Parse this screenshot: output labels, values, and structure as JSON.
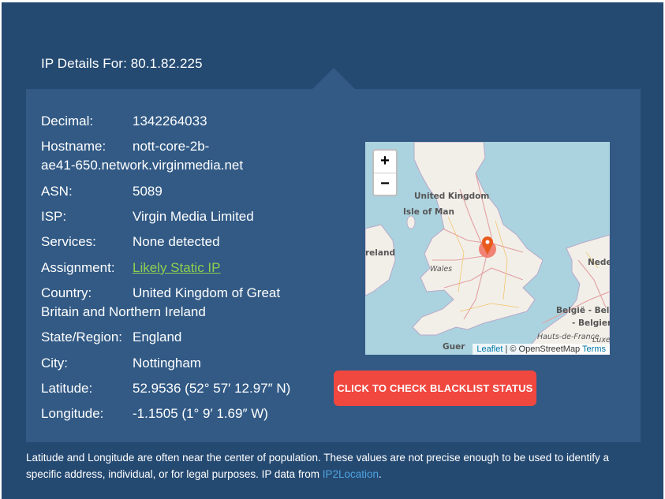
{
  "header": {
    "title_prefix": "IP Details For:",
    "ip": "80.1.82.225"
  },
  "details": {
    "decimal": {
      "label": "Decimal:",
      "value": "1342264033"
    },
    "hostname": {
      "label": "Hostname:",
      "value_line1": "nott-core-2b-",
      "value_line2": "ae41-650.network.virginmedia.net"
    },
    "asn": {
      "label": "ASN:",
      "value": "5089"
    },
    "isp": {
      "label": "ISP:",
      "value": "Virgin Media Limited"
    },
    "services": {
      "label": "Services:",
      "value": "None detected"
    },
    "assignment": {
      "label": "Assignment:",
      "value": "Likely Static IP"
    },
    "country": {
      "label": "Country:",
      "value_line1": "United Kingdom of Great",
      "value_line2": "Britain and Northern Ireland"
    },
    "state": {
      "label": "State/Region:",
      "value": "England"
    },
    "city": {
      "label": "City:",
      "value": "Nottingham"
    },
    "latitude": {
      "label": "Latitude:",
      "value": "52.9536 (52° 57′ 12.97″ N)"
    },
    "longitude": {
      "label": "Longitude:",
      "value": "-1.1505 (1° 9′ 1.69″ W)"
    }
  },
  "map": {
    "zoom_in": "+",
    "zoom_out": "−",
    "labels": {
      "uk": "United Kingdom",
      "isle_of_man": "Isle of Man",
      "ireland": "reland",
      "wales": "Wales",
      "nederland": "Nede",
      "belgie": "België - Belgi",
      "belgien": "- Belgien",
      "hauts": "Hauts-de-France",
      "luxe": "Luxe",
      "guer": "Guer"
    },
    "attribution": {
      "leaflet": "Leaflet",
      "sep": " | © OpenStreetMap ",
      "terms": "Terms"
    },
    "colors": {
      "sea": "#aad3df",
      "land": "#f2efe9",
      "marker": "#e85a1c"
    }
  },
  "blacklist_button": "CLICK TO CHECK BLACKLIST STATUS",
  "footnote": {
    "text": "Latitude and Longitude are often near the center of population. These values are not precise enough to be used to identify a specific address, individual, or for legal purposes. IP data from ",
    "link": "IP2Location",
    "end": "."
  }
}
